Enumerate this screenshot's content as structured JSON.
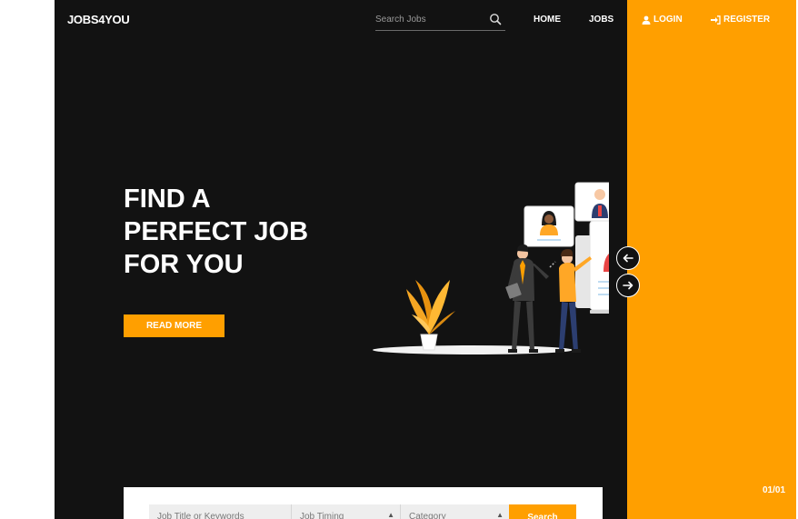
{
  "header": {
    "brand": "JOBS4YOU",
    "search_placeholder": "Search Jobs",
    "nav": {
      "home": "HOME",
      "jobs": "JOBS",
      "login": "LOGIN",
      "register": "REGISTER"
    }
  },
  "hero": {
    "title_lines": [
      "FIND A",
      "PERFECT JOB",
      "FOR YOU"
    ],
    "cta": "READ MORE",
    "slide_counter": "01/01",
    "prev_arrow": "←",
    "next_arrow": "→"
  },
  "search_form": {
    "keyword_placeholder": "Job Title or Keywords",
    "timing_label": "Job Timing",
    "category_label": "Category",
    "submit": "Search"
  },
  "colors": {
    "accent": "#ff9f00",
    "background": "#121212"
  }
}
